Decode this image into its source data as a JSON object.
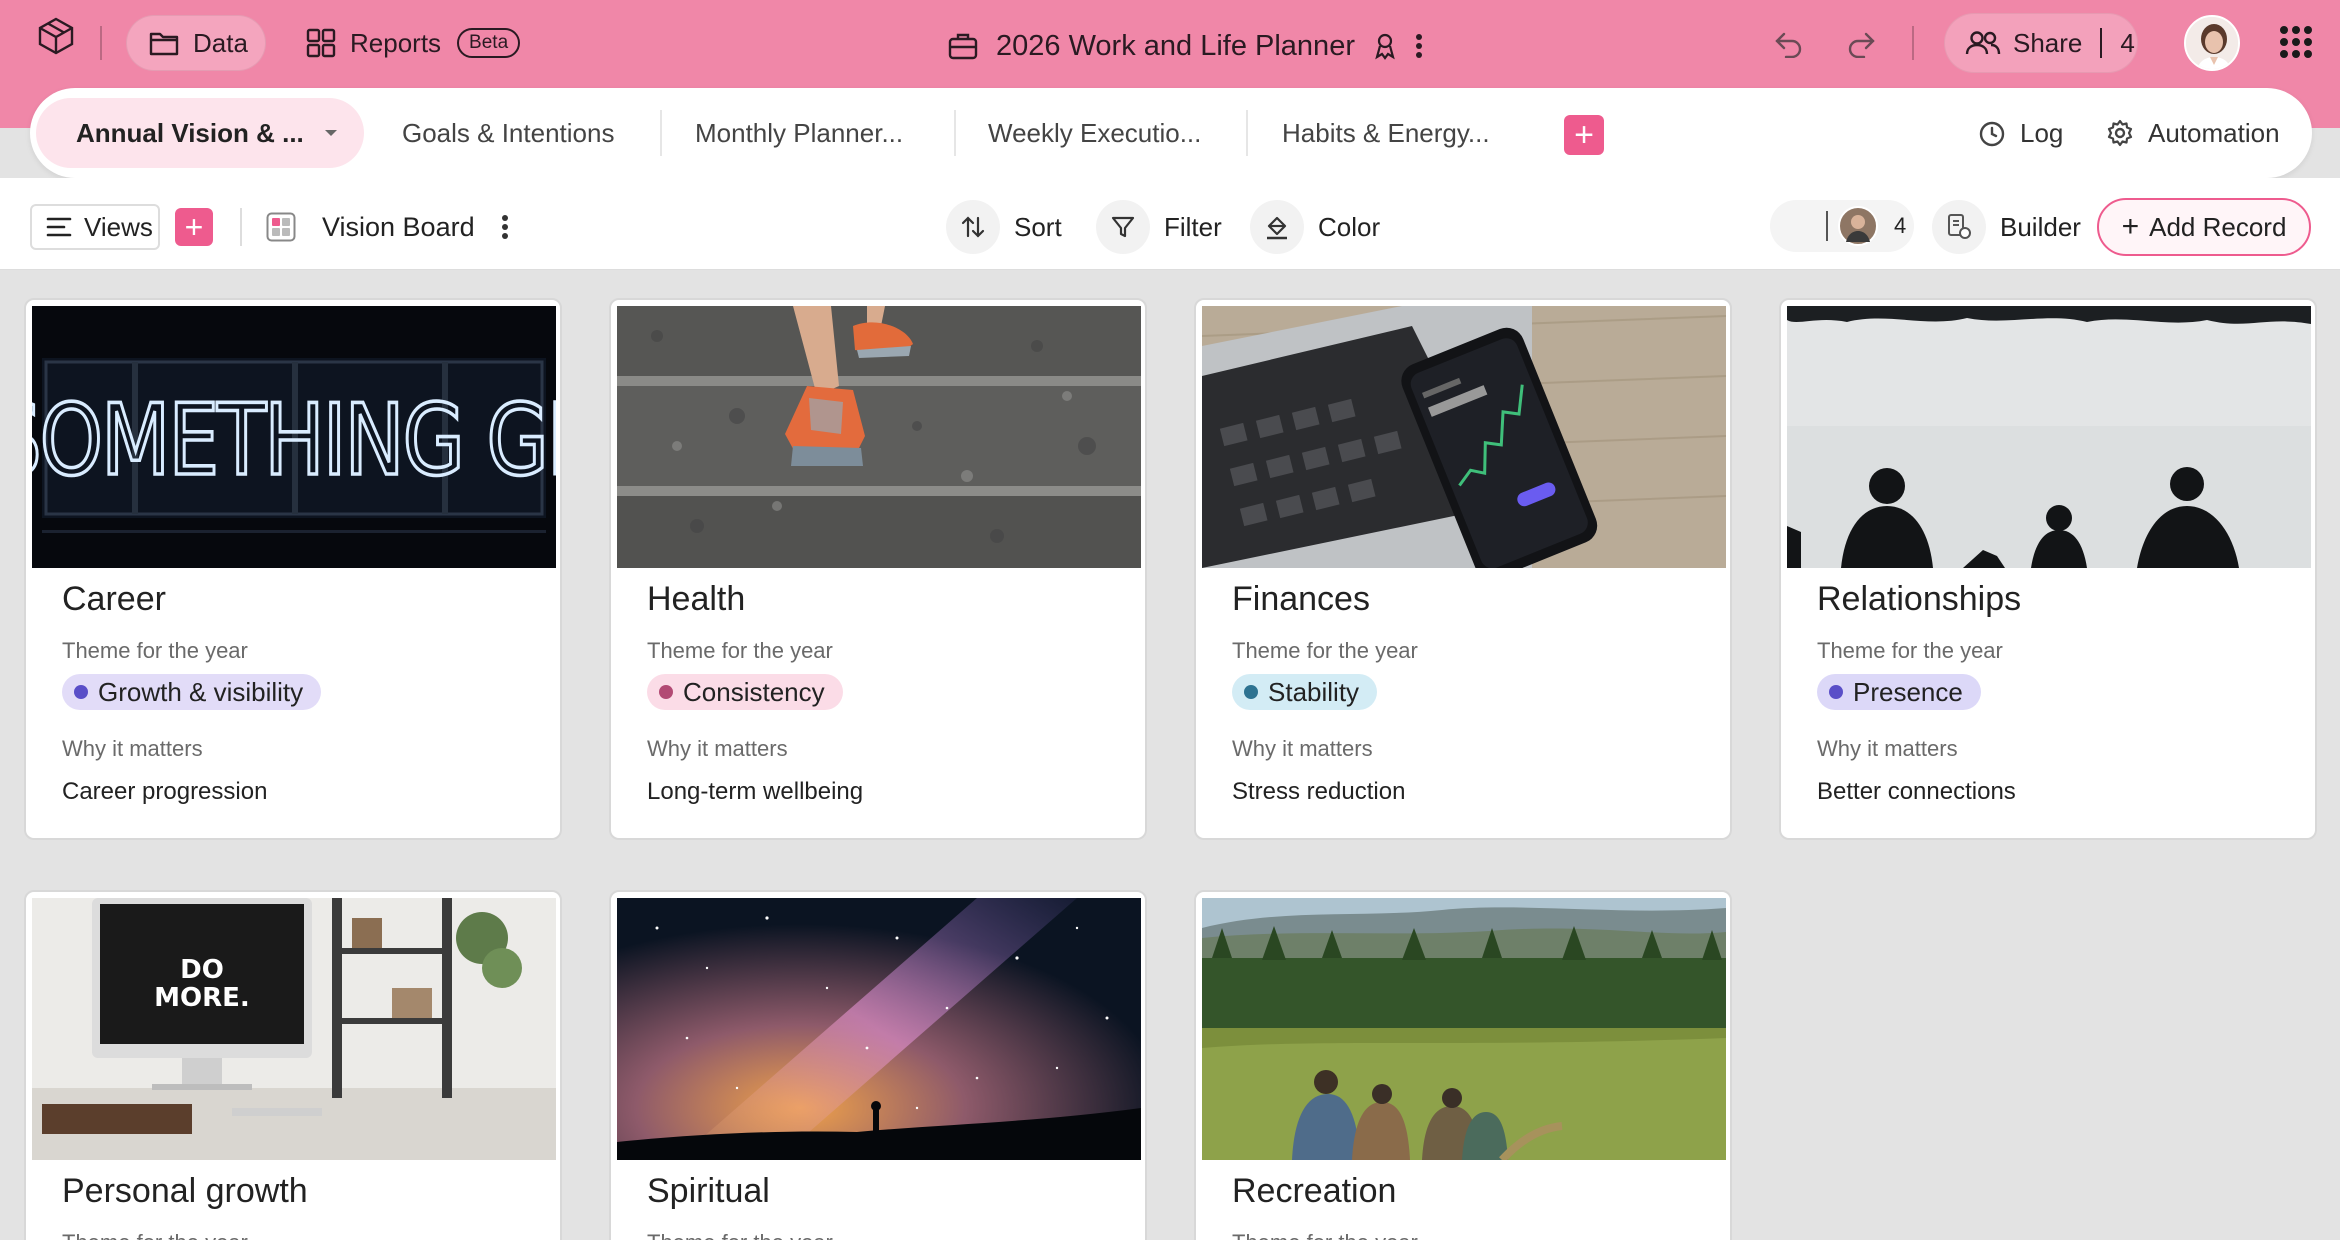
{
  "topbar": {
    "data_label": "Data",
    "reports_label": "Reports",
    "beta_badge": "Beta",
    "doc_title": "2026 Work and Life Planner",
    "share_label": "Share",
    "share_count": "4",
    "accent": "#f087a8"
  },
  "tabs": {
    "active": "Annual Vision & ...",
    "items": [
      "Goals & Intentions",
      "Monthly Planner...",
      "Weekly Executio...",
      "Habits & Energy..."
    ],
    "log": "Log",
    "automation": "Automation"
  },
  "toolbar": {
    "views_label": "Views",
    "view_name": "Vision Board",
    "sort_label": "Sort",
    "filter_label": "Filter",
    "color_label": "Color",
    "collaborator_count": "4",
    "builder_label": "Builder",
    "add_record_label": "Add Record",
    "primary_color": "#ee5b8e"
  },
  "field_labels": {
    "theme": "Theme for the year",
    "why": "Why it matters"
  },
  "cards": [
    {
      "title": "Career",
      "theme": "Growth & visibility",
      "chip_bg": "#e2dcf8",
      "dot": "#5a4fc8",
      "why": "Career progression",
      "image": "neon-sign"
    },
    {
      "title": "Health",
      "theme": "Consistency",
      "chip_bg": "#fbdce7",
      "dot": "#b24a74",
      "why": "Long-term wellbeing",
      "image": "runner-stairs"
    },
    {
      "title": "Finances",
      "theme": "Stability",
      "chip_bg": "#d3ecf5",
      "dot": "#2e7391",
      "why": "Stress reduction",
      "image": "laptop-phone"
    },
    {
      "title": "Relationships",
      "theme": "Presence",
      "chip_bg": "#dcd8f8",
      "dot": "#5a4fc8",
      "why": "Better connections",
      "image": "friends-lake"
    },
    {
      "title": "Personal growth",
      "image": "desk-computer"
    },
    {
      "title": "Spiritual",
      "image": "milky-way"
    },
    {
      "title": "Recreation",
      "image": "hikers-meadow"
    }
  ]
}
